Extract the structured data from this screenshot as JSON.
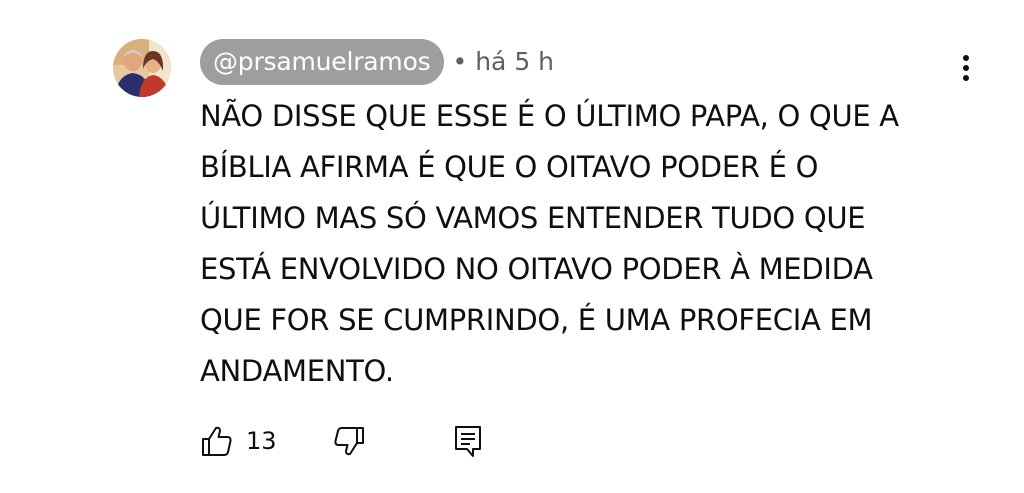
{
  "comment": {
    "author": "@prsamuelramos",
    "separator": "•",
    "timestamp": "há 5 h",
    "text": "NÃO DISSE QUE ESSE É O ÚLTIMO PAPA, O QUE A\nBÍBLIA AFIRMA É QUE O OITAVO PODER É O\nÚLTIMO MAS SÓ VAMOS ENTENDER TUDO QUE\nESTÁ ENVOLVIDO NO OITAVO PODER À MEDIDA\nQUE FOR SE CUMPRINDO, É UMA PROFECIA EM\nANDAMENTO.",
    "like_count": "13"
  },
  "icons": {
    "avatar": "avatar",
    "more": "more-vert-icon",
    "like": "thumbs-up-icon",
    "dislike": "thumbs-down-icon",
    "reply": "reply-comment-icon"
  },
  "colors": {
    "author_chip_bg": "#9e9e9e",
    "author_chip_text": "#ffffff",
    "meta_text": "#606060",
    "body_text": "#0f0f0f"
  }
}
